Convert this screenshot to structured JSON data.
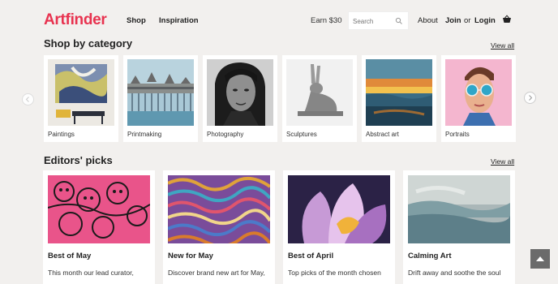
{
  "header": {
    "logo": "Artfinder",
    "nav": [
      "Shop",
      "Inspiration"
    ],
    "earn": "Earn $30",
    "search_placeholder": "Search",
    "about": "About",
    "join": "Join",
    "or": "or",
    "login": "Login",
    "colors": {
      "brand": "#e8324f"
    }
  },
  "categories": {
    "title": "Shop by category",
    "view_all": "View all",
    "items": [
      {
        "label": "Paintings"
      },
      {
        "label": "Printmaking"
      },
      {
        "label": "Photography"
      },
      {
        "label": "Sculptures"
      },
      {
        "label": "Abstract art"
      },
      {
        "label": "Portraits"
      }
    ]
  },
  "picks": {
    "title": "Editors' picks",
    "view_all": "View all",
    "items": [
      {
        "title": "Best of May",
        "desc": "This month our lead curator,"
      },
      {
        "title": "New for May",
        "desc": "Discover brand new art for May,"
      },
      {
        "title": "Best of April",
        "desc": "Top picks of the month chosen"
      },
      {
        "title": "Calming Art",
        "desc": "Drift away and soothe the soul"
      }
    ]
  }
}
